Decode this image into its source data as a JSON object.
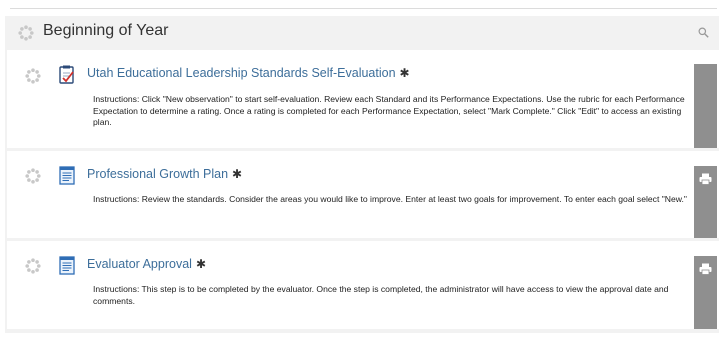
{
  "section": {
    "title": "Beginning of Year",
    "icons": {
      "spinner": "loading-spinner-icon",
      "search": "zoom-icon"
    }
  },
  "steps": [
    {
      "title": "Utah Educational Leadership Standards Self-Evaluation",
      "required_mark": "✱",
      "icon": "evaluation-clipboard-icon",
      "instructions": "Instructions: Click \"New observation\" to start self-evaluation. Review each Standard and its Performance Expectations. Use the rubric for each Performance Expectation to determine a rating. Once a rating is completed for each Performance Expectation, select \"Mark Complete.\" Click \"Edit\" to access an existing plan.",
      "has_print": false
    },
    {
      "title": "Professional Growth Plan",
      "required_mark": "✱",
      "icon": "document-icon",
      "instructions": "Instructions: Review the standards. Consider the areas you would like to improve. Enter at least two goals for improvement. To enter each goal select \"New.\"",
      "has_print": true
    },
    {
      "title": "Evaluator Approval",
      "required_mark": "✱",
      "icon": "document-icon",
      "instructions": "Instructions: This step is to be completed by the evaluator. Once the step is completed, the administrator will have access to view the approval date and comments.",
      "has_print": true
    }
  ],
  "colors": {
    "panel_bg": "#f2f2f2",
    "link": "#3d6e9a",
    "side_bar": "#8f8f8f"
  }
}
